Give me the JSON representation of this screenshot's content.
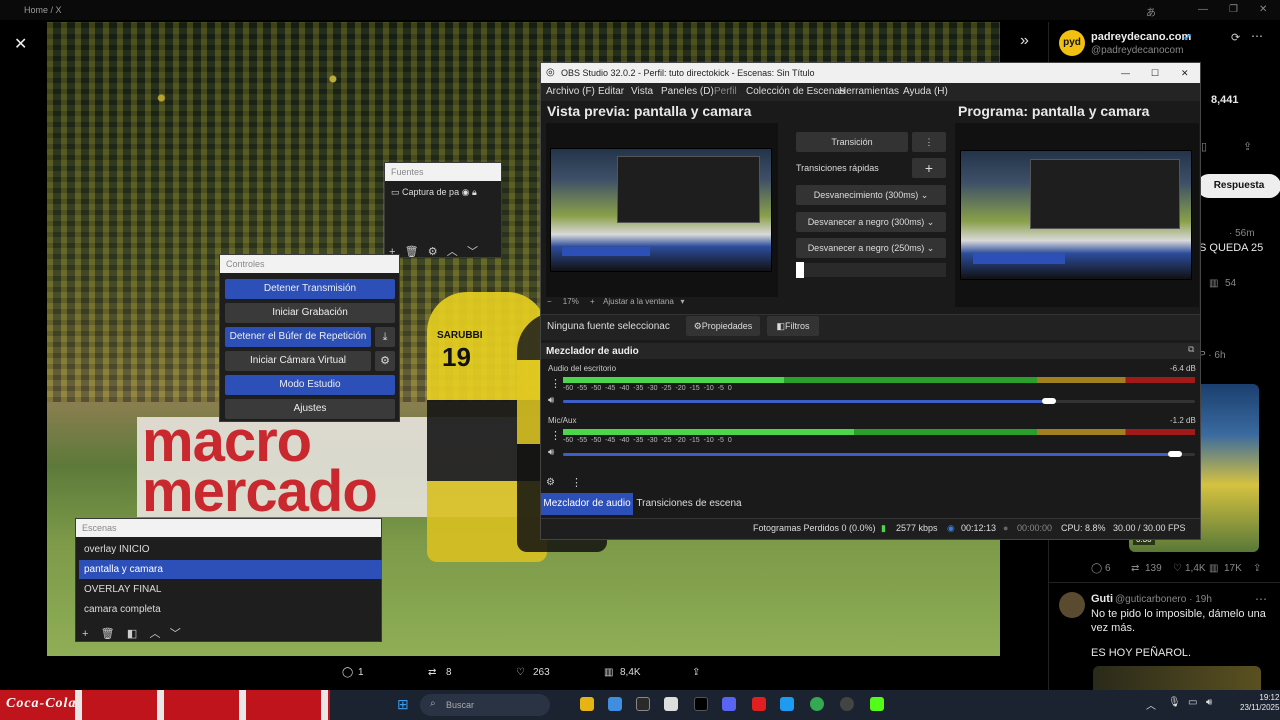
{
  "browser": {
    "breadcrumb": "Home / X"
  },
  "viewer": {
    "close": "✕",
    "expand": "»"
  },
  "photo": {
    "adboard_line1": "macro",
    "adboard_line2": "mercado",
    "shirt_name": "SARUBBI",
    "shirt_number": "19"
  },
  "tweet": {
    "avatar_text": "pyd",
    "name": "padreydecano.com",
    "handle": "@padreydecanocom",
    "views": "8,441",
    "reply_button": "Respuesta",
    "reply1_time": "· 56m",
    "reply1_text": "S QUEDA 25",
    "reply1_views": "54",
    "reply2_time": "P · 6h",
    "reply2_stats": {
      "comments": "6",
      "retweets": "139",
      "likes": "1,4K",
      "views": "17K"
    },
    "reply3_name": "Guti",
    "reply3_handle": "@guticarbonero · 19h",
    "reply3_text1": "No te pido lo imposible, dámelo una vez más.",
    "reply3_text2": "ES HOY PEÑAROL.",
    "video_time": "0:30"
  },
  "actions": {
    "comments": "1",
    "retweets": "8",
    "likes": "263",
    "views": "8,4K"
  },
  "fuentes": {
    "title": "Fuentes",
    "source": "Captura de pa"
  },
  "controles": {
    "title": "Controles",
    "stop_stream": "Detener Transmisión",
    "start_rec": "Iniciar Grabación",
    "stop_buffer": "Detener el Búfer de Repetición",
    "virtual_cam": "Iniciar Cámara Virtual",
    "studio_mode": "Modo Estudio",
    "settings": "Ajustes"
  },
  "escenas": {
    "title": "Escenas",
    "items": [
      "overlay INICIO",
      "pantalla y camara",
      "OVERLAY FINAL",
      "camara completa"
    ]
  },
  "obs": {
    "title": "OBS Studio 32.0.2 - Perfil: tuto directokick - Escenas: Sin Título",
    "menu": [
      "Archivo (F)",
      "Editar",
      "Vista",
      "Paneles (D)",
      "Perfil",
      "Colección de Escenas",
      "Herramientas",
      "Ayuda (H)"
    ],
    "preview_title": "Vista previa: pantalla y camara",
    "program_title": "Programa: pantalla y camara",
    "transition_btn": "Transición",
    "quick_transitions": "Transiciones rápidas",
    "tr1": "Desvanecimiento (300ms)",
    "tr2": "Desvanecer a negro (300ms)",
    "tr3": "Desvanecer a negro (250ms)",
    "zoom": "17%",
    "fit": "Ajustar a la ventana",
    "no_source": "Ninguna fuente seleccionac",
    "properties": "Propiedades",
    "filters": "Filtros",
    "mixer_title": "Mezclador de audio",
    "ch1_name": "Audio del escritorio",
    "ch1_db": "-6.4 dB",
    "ch1_level": 0.35,
    "ch1_volume": 0.78,
    "ch2_name": "Mic/Aux",
    "ch2_db": "-1.2 dB",
    "ch2_level": 0.46,
    "ch2_volume": 0.98,
    "ticks": "-60    -55    -50    -45    -40    -35    -30    -25    -20    -15    -10    -5    0",
    "tab_mixer": "Mezclador de audio",
    "tab_transitions": "Transiciones de escena",
    "dropped": "Fotogramas Perdidos 0 (0.0%)",
    "kbps": "2577 kbps",
    "live_time": "00:12:13",
    "rec_time": "00:00:00",
    "cpu": "CPU: 8.8%",
    "fps": "30.00 / 30.00 FPS"
  },
  "taskbar": {
    "brand": "Coca-Cola",
    "search": "Buscar",
    "time": "19:12",
    "date": "23/11/2025"
  }
}
